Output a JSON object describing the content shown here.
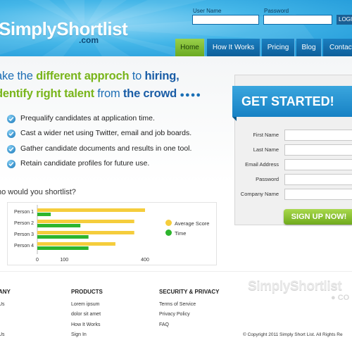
{
  "brand": {
    "name": "SimplyShortlist",
    "suffix": ".com"
  },
  "login": {
    "user_label": "User Name",
    "password_label": "Password",
    "user_value": "",
    "password_value": "",
    "button_label": "LOGIN"
  },
  "nav": [
    {
      "label": "Home",
      "active": true
    },
    {
      "label": "How It Works",
      "active": false
    },
    {
      "label": "Pricing",
      "active": false
    },
    {
      "label": "Blog",
      "active": false
    },
    {
      "label": "Contact",
      "active": false
    }
  ],
  "hero": {
    "line1": {
      "p1": "ake the ",
      "p2": "different approch",
      "p3": " to ",
      "p4": "hiring,"
    },
    "line2": {
      "p1": "dentify right talent",
      "p2": " from ",
      "p3": "the crowd",
      "p4": "●●●●"
    },
    "bullets": [
      "Prequalify candidates at application time.",
      "Cast a wider net using Twitter, email and job boards.",
      "Gather candidate documents and results in one tool.",
      "Retain candidate profiles for future use."
    ]
  },
  "form": {
    "title": "GET STARTED!",
    "fields": [
      {
        "label": "First Name",
        "value": ""
      },
      {
        "label": "Last Name",
        "value": ""
      },
      {
        "label": "Email Address",
        "value": ""
      },
      {
        "label": "Password",
        "value": ""
      },
      {
        "label": "Company Name",
        "value": ""
      }
    ],
    "submit_label": "SIGN UP NOW!"
  },
  "question": "ho would you shortlist?",
  "chart_data": {
    "type": "bar",
    "orientation": "horizontal",
    "categories": [
      "Person 1",
      "Person 2",
      "Person 3",
      "Person 4"
    ],
    "series": [
      {
        "name": "Average Score",
        "color": "#f5cd3c",
        "values": [
          400,
          360,
          360,
          290
        ]
      },
      {
        "name": "Time",
        "color": "#2db52d",
        "values": [
          50,
          160,
          190,
          190
        ]
      }
    ],
    "xticks": [
      "0",
      "100",
      "400"
    ],
    "legend": "right"
  },
  "footer": {
    "columns": [
      {
        "heading": "ANY",
        "links": [
          "Us",
          "",
          "",
          "Us"
        ]
      },
      {
        "heading": "PRODUCTS",
        "links": [
          "Lorem ipsum",
          "dolor sit amet",
          "How It Works",
          "Sign In"
        ]
      },
      {
        "heading": "SECURITY & PRIVACY",
        "links": [
          "Terms of Service",
          "Privacy Policy",
          "FAQ"
        ]
      }
    ],
    "logo_name": "SimplyShortlist",
    "logo_suffix": "● CO",
    "copyright": "© Copyright 2011 Simply Short List. All Rights Re"
  },
  "colors": {
    "header_blue": "#44b6e8",
    "nav_blue": "#0e5f9a",
    "accent_green": "#79b51b",
    "headline_blue": "#1a5da6"
  }
}
